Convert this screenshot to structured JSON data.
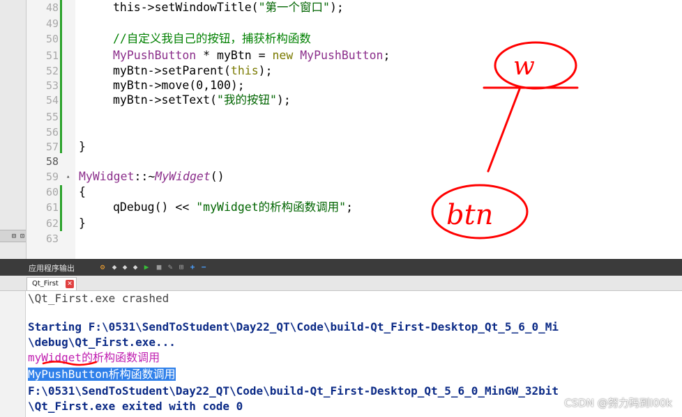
{
  "editor": {
    "line_numbers": [
      "48",
      "49",
      "50",
      "51",
      "52",
      "53",
      "54",
      "55",
      "56",
      "57",
      "58",
      "59",
      "60",
      "61",
      "62",
      "63"
    ],
    "current_line": "58",
    "lines": {
      "l48": [
        {
          "t": "this->setWindowTitle(",
          "c": "plain"
        },
        {
          "t": "\"第一个窗口\"",
          "c": "str"
        },
        {
          "t": ");",
          "c": "plain"
        }
      ],
      "l50": [
        {
          "t": "//自定义我自己的按钮，捕获析构函数",
          "c": "com"
        }
      ],
      "l51": [
        {
          "t": "MyPushButton",
          "c": "type"
        },
        {
          "t": " * myBtn = ",
          "c": "plain"
        },
        {
          "t": "new",
          "c": "kw"
        },
        {
          "t": " ",
          "c": "plain"
        },
        {
          "t": "MyPushButton",
          "c": "type"
        },
        {
          "t": ";",
          "c": "plain"
        }
      ],
      "l52": [
        {
          "t": "myBtn->setParent(",
          "c": "plain"
        },
        {
          "t": "this",
          "c": "kw"
        },
        {
          "t": ");",
          "c": "plain"
        }
      ],
      "l53": [
        {
          "t": "myBtn->move(0,100);",
          "c": "plain"
        }
      ],
      "l54": [
        {
          "t": "myBtn->setText(",
          "c": "plain"
        },
        {
          "t": "\"我的按钮\"",
          "c": "str"
        },
        {
          "t": ");",
          "c": "plain"
        }
      ],
      "l57": [
        {
          "t": "}",
          "c": "plain"
        }
      ],
      "l59": [
        {
          "t": "MyWidget",
          "c": "type"
        },
        {
          "t": "::~",
          "c": "plain"
        },
        {
          "t": "MyWidget",
          "c": "type-it"
        },
        {
          "t": "()",
          "c": "plain"
        }
      ],
      "l60": [
        {
          "t": "{",
          "c": "plain"
        }
      ],
      "l61": [
        {
          "t": "qDebug() << ",
          "c": "plain"
        },
        {
          "t": "\"myWidget的析构函数调用\"",
          "c": "str"
        },
        {
          "t": ";",
          "c": "plain"
        }
      ],
      "l62": [
        {
          "t": "}",
          "c": "plain"
        }
      ]
    },
    "fold_marker": "▴"
  },
  "annotation": {
    "top_label": "w",
    "bottom_label": "btn",
    "color": "#ff0000"
  },
  "output_pane": {
    "title": "应用程序输出",
    "tab_label": "Qt_First",
    "tab_close": "✕",
    "left_strip_label": "⊟ ⊡",
    "lines": [
      {
        "text": "\\Qt_First.exe crashed",
        "style": "normal"
      },
      {
        "text": "",
        "style": "normal"
      },
      {
        "text": "Starting F:\\0531\\SendToStudent\\Day22_QT\\Code\\build-Qt_First-Desktop_Qt_5_6_0_Mi",
        "style": "bold"
      },
      {
        "text": "\\debug\\Qt_First.exe...",
        "style": "bold"
      },
      {
        "text": "myWidget的析构函数调用",
        "style": "purple"
      },
      {
        "text": "MyPushButton析构函数调用",
        "style": "sel"
      },
      {
        "text": "F:\\0531\\SendToStudent\\Day22_QT\\Code\\build-Qt_First-Desktop_Qt_5_6_0_MinGW_32bit",
        "style": "bold"
      },
      {
        "text": "\\Qt_First.exe exited with code 0",
        "style": "bold"
      }
    ]
  },
  "watermark": "CSDN @努力码到I00k",
  "colors": {
    "accent_selection": "#2f80ea",
    "output_bold": "#0b2a86",
    "qdebug_purple": "#c01eb0",
    "change_bar_green": "#2aa22a"
  }
}
